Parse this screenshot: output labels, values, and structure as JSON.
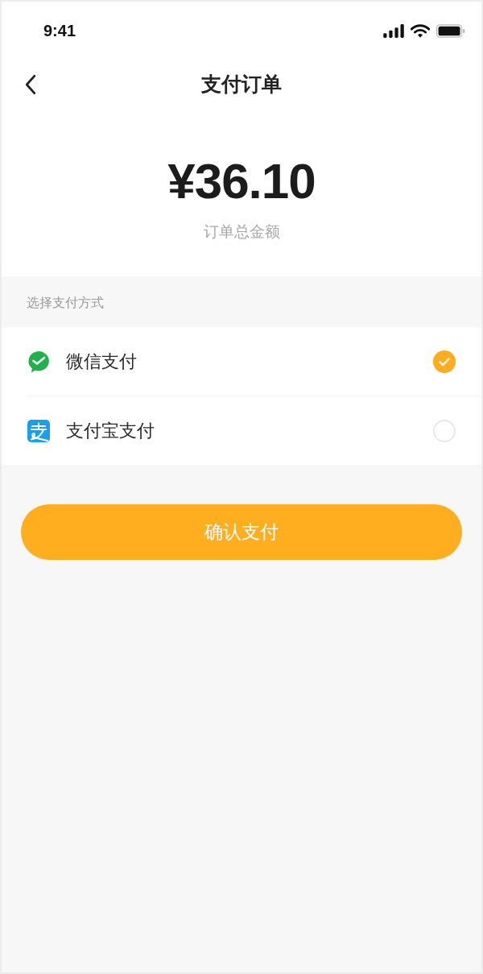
{
  "status_bar": {
    "time": "9:41"
  },
  "nav": {
    "title": "支付订单"
  },
  "amount": {
    "value": "¥36.10",
    "label": "订单总金额"
  },
  "payment_section": {
    "heading": "选择支付方式",
    "methods": [
      {
        "kind": "wechat",
        "label": "微信支付",
        "selected": true
      },
      {
        "kind": "alipay",
        "label": "支付宝支付",
        "selected": false
      }
    ]
  },
  "confirm_button": {
    "label": "确认支付"
  }
}
